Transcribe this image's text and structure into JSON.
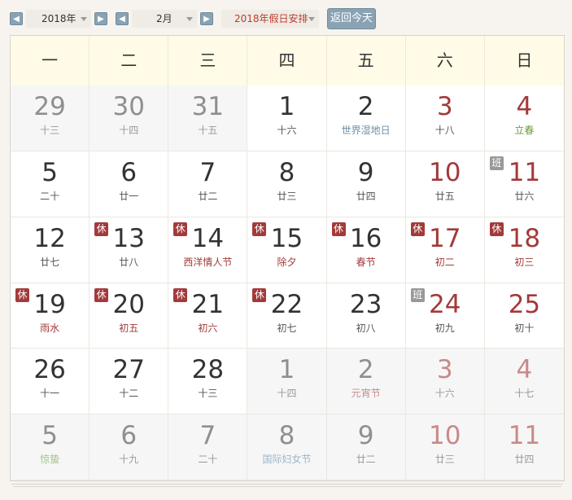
{
  "toolbar": {
    "prev_year_icon": "chevron-left-icon",
    "year_value": "2018年",
    "next_year_icon": "chevron-right-icon",
    "prev_month_icon": "chevron-left-icon",
    "month_value": "2月",
    "next_month_icon": "chevron-right-icon",
    "holiday_select": "2018年假日安排",
    "today_button": "返回今天"
  },
  "weekdays": [
    "一",
    "二",
    "三",
    "四",
    "五",
    "六",
    "日"
  ],
  "badges": {
    "rest": "休",
    "work": "班"
  },
  "colors": {
    "accent": "#8aa3b4",
    "holiday_red": "#a33a3a",
    "header_bg": "#fffbe6"
  },
  "days": [
    {
      "day": "29",
      "lunar": "十三",
      "other": true,
      "weekend": false,
      "fest": "",
      "badge": ""
    },
    {
      "day": "30",
      "lunar": "十四",
      "other": true,
      "weekend": false,
      "fest": "",
      "badge": ""
    },
    {
      "day": "31",
      "lunar": "十五",
      "other": true,
      "weekend": false,
      "fest": "",
      "badge": ""
    },
    {
      "day": "1",
      "lunar": "十六",
      "other": false,
      "weekend": false,
      "fest": "",
      "badge": ""
    },
    {
      "day": "2",
      "lunar": "世界湿地日",
      "other": false,
      "weekend": false,
      "fest": "blue",
      "badge": ""
    },
    {
      "day": "3",
      "lunar": "十八",
      "other": false,
      "weekend": true,
      "fest": "",
      "badge": ""
    },
    {
      "day": "4",
      "lunar": "立春",
      "other": false,
      "weekend": true,
      "fest": "green",
      "badge": ""
    },
    {
      "day": "5",
      "lunar": "二十",
      "other": false,
      "weekend": false,
      "fest": "",
      "badge": ""
    },
    {
      "day": "6",
      "lunar": "廿一",
      "other": false,
      "weekend": false,
      "fest": "",
      "badge": ""
    },
    {
      "day": "7",
      "lunar": "廿二",
      "other": false,
      "weekend": false,
      "fest": "",
      "badge": ""
    },
    {
      "day": "8",
      "lunar": "廿三",
      "other": false,
      "weekend": false,
      "fest": "",
      "badge": ""
    },
    {
      "day": "9",
      "lunar": "廿四",
      "other": false,
      "weekend": false,
      "fest": "",
      "badge": ""
    },
    {
      "day": "10",
      "lunar": "廿五",
      "other": false,
      "weekend": true,
      "fest": "",
      "badge": ""
    },
    {
      "day": "11",
      "lunar": "廿六",
      "other": false,
      "weekend": true,
      "fest": "",
      "badge": "work"
    },
    {
      "day": "12",
      "lunar": "廿七",
      "other": false,
      "weekend": false,
      "fest": "",
      "badge": ""
    },
    {
      "day": "13",
      "lunar": "廿八",
      "other": false,
      "weekend": false,
      "fest": "",
      "badge": "rest"
    },
    {
      "day": "14",
      "lunar": "西洋情人节",
      "other": false,
      "weekend": false,
      "fest": "red",
      "badge": "rest"
    },
    {
      "day": "15",
      "lunar": "除夕",
      "other": false,
      "weekend": false,
      "fest": "red",
      "badge": "rest"
    },
    {
      "day": "16",
      "lunar": "春节",
      "other": false,
      "weekend": false,
      "fest": "red",
      "badge": "rest"
    },
    {
      "day": "17",
      "lunar": "初二",
      "other": false,
      "weekend": true,
      "fest": "red",
      "badge": "rest"
    },
    {
      "day": "18",
      "lunar": "初三",
      "other": false,
      "weekend": true,
      "fest": "red",
      "badge": "rest"
    },
    {
      "day": "19",
      "lunar": "雨水",
      "other": false,
      "weekend": false,
      "fest": "red",
      "badge": "rest"
    },
    {
      "day": "20",
      "lunar": "初五",
      "other": false,
      "weekend": false,
      "fest": "red",
      "badge": "rest"
    },
    {
      "day": "21",
      "lunar": "初六",
      "other": false,
      "weekend": false,
      "fest": "red",
      "badge": "rest"
    },
    {
      "day": "22",
      "lunar": "初七",
      "other": false,
      "weekend": false,
      "fest": "",
      "badge": "rest"
    },
    {
      "day": "23",
      "lunar": "初八",
      "other": false,
      "weekend": false,
      "fest": "",
      "badge": ""
    },
    {
      "day": "24",
      "lunar": "初九",
      "other": false,
      "weekend": true,
      "fest": "",
      "badge": "work"
    },
    {
      "day": "25",
      "lunar": "初十",
      "other": false,
      "weekend": true,
      "fest": "",
      "badge": ""
    },
    {
      "day": "26",
      "lunar": "十一",
      "other": false,
      "weekend": false,
      "fest": "",
      "badge": ""
    },
    {
      "day": "27",
      "lunar": "十二",
      "other": false,
      "weekend": false,
      "fest": "",
      "badge": ""
    },
    {
      "day": "28",
      "lunar": "十三",
      "other": false,
      "weekend": false,
      "fest": "",
      "badge": ""
    },
    {
      "day": "1",
      "lunar": "十四",
      "other": true,
      "weekend": false,
      "fest": "",
      "badge": ""
    },
    {
      "day": "2",
      "lunar": "元宵节",
      "other": true,
      "weekend": false,
      "fest": "red",
      "badge": ""
    },
    {
      "day": "3",
      "lunar": "十六",
      "other": true,
      "weekend": true,
      "fest": "",
      "badge": ""
    },
    {
      "day": "4",
      "lunar": "十七",
      "other": true,
      "weekend": true,
      "fest": "",
      "badge": ""
    },
    {
      "day": "5",
      "lunar": "惊蛰",
      "other": true,
      "weekend": false,
      "fest": "green",
      "badge": ""
    },
    {
      "day": "6",
      "lunar": "十九",
      "other": true,
      "weekend": false,
      "fest": "",
      "badge": ""
    },
    {
      "day": "7",
      "lunar": "二十",
      "other": true,
      "weekend": false,
      "fest": "",
      "badge": ""
    },
    {
      "day": "8",
      "lunar": "国际妇女节",
      "other": true,
      "weekend": false,
      "fest": "blue",
      "badge": ""
    },
    {
      "day": "9",
      "lunar": "廿二",
      "other": true,
      "weekend": false,
      "fest": "",
      "badge": ""
    },
    {
      "day": "10",
      "lunar": "廿三",
      "other": true,
      "weekend": true,
      "fest": "",
      "badge": ""
    },
    {
      "day": "11",
      "lunar": "廿四",
      "other": true,
      "weekend": true,
      "fest": "",
      "badge": ""
    }
  ]
}
